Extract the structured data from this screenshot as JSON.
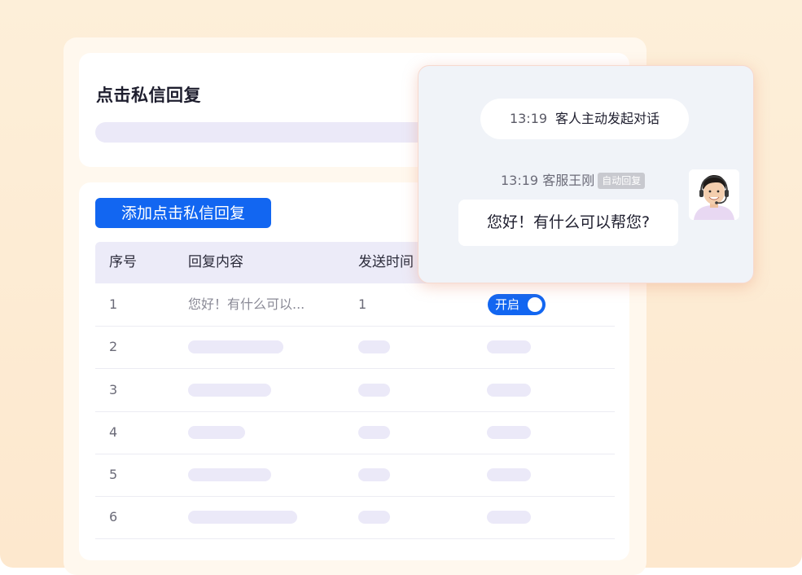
{
  "panel": {
    "title": "点击私信回复",
    "add_button": "添加点击私信回复"
  },
  "table": {
    "headers": [
      "序号",
      "回复内容",
      "发送时间"
    ],
    "rows": [
      {
        "num": "1",
        "content": "您好！有什么可以...",
        "time": "1",
        "toggle": "开启"
      },
      {
        "num": "2"
      },
      {
        "num": "3"
      },
      {
        "num": "4"
      },
      {
        "num": "5"
      },
      {
        "num": "6"
      }
    ]
  },
  "chat": {
    "system_time": "13:19",
    "system_text": "客人主动发起对话",
    "agent_time": "13:19",
    "agent_name": "客服王刚",
    "auto_badge": "自动回复",
    "message": "您好！有什么可以帮您?"
  },
  "colors": {
    "accent": "#1266f1",
    "background": "#fdefd9",
    "placeholder": "#ebe9f8"
  }
}
